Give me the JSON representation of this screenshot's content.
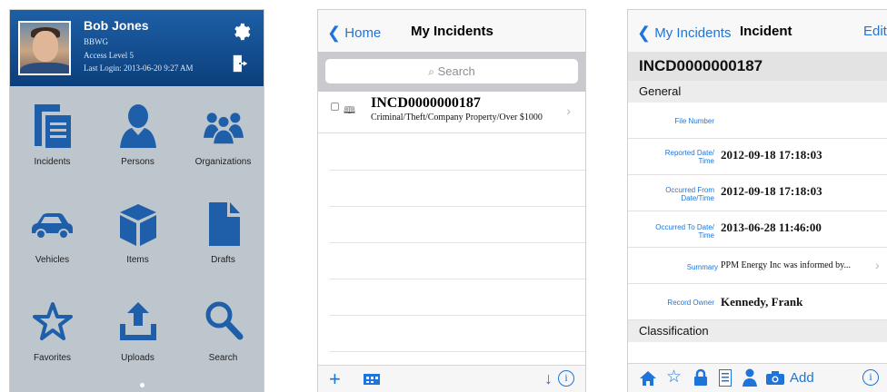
{
  "home": {
    "user": {
      "name": "Bob Jones",
      "org": "BBWG",
      "access": "Access Level 5",
      "last_login": "Last Login: 2013-06-20 9:27 AM"
    },
    "tiles": [
      {
        "label": "Incidents",
        "icon": "incidents-icon"
      },
      {
        "label": "Persons",
        "icon": "person-icon"
      },
      {
        "label": "Organizations",
        "icon": "organizations-icon"
      },
      {
        "label": "Vehicles",
        "icon": "car-icon"
      },
      {
        "label": "Items",
        "icon": "box-icon"
      },
      {
        "label": "Drafts",
        "icon": "document-icon"
      },
      {
        "label": "Favorites",
        "icon": "star-icon"
      },
      {
        "label": "Uploads",
        "icon": "upload-icon"
      },
      {
        "label": "Search",
        "icon": "search-icon"
      }
    ],
    "colors": {
      "header": "#0c3f7c",
      "icon": "#1f5ea8",
      "background": "#bcc6cc"
    }
  },
  "list": {
    "back_label": "Home",
    "title": "My Incidents",
    "search_placeholder": "Search",
    "incidents": [
      {
        "number": "INCD0000000187",
        "description": "Criminal/Theft/Company Property/Over $1000"
      }
    ]
  },
  "detail": {
    "back_label": "My Incidents",
    "title": "Incident",
    "edit_label": "Edit",
    "incident_number": "INCD0000000187",
    "sections": {
      "general": "General",
      "classification": "Classification"
    },
    "fields": {
      "file_number": {
        "label": "File Number",
        "value": ""
      },
      "reported": {
        "label_1": "Reported Date/",
        "label_2": "Time",
        "value": "2012-09-18 17:18:03"
      },
      "occurred_from": {
        "label_1": "Occurred From",
        "label_2": "Date/Time",
        "value": "2012-09-18 17:18:03"
      },
      "occurred_to": {
        "label_1": "Occurred To Date/",
        "label_2": "Time",
        "value": "2013-06-28 11:46:00"
      },
      "summary": {
        "label": "Summary",
        "value": "PPM Energy Inc was informed by..."
      },
      "record_owner": {
        "label": "Record Owner",
        "value": "Kennedy, Frank"
      }
    },
    "toolbar": {
      "add_label": "Add"
    },
    "colors": {
      "accent": "#1e74d8"
    }
  }
}
